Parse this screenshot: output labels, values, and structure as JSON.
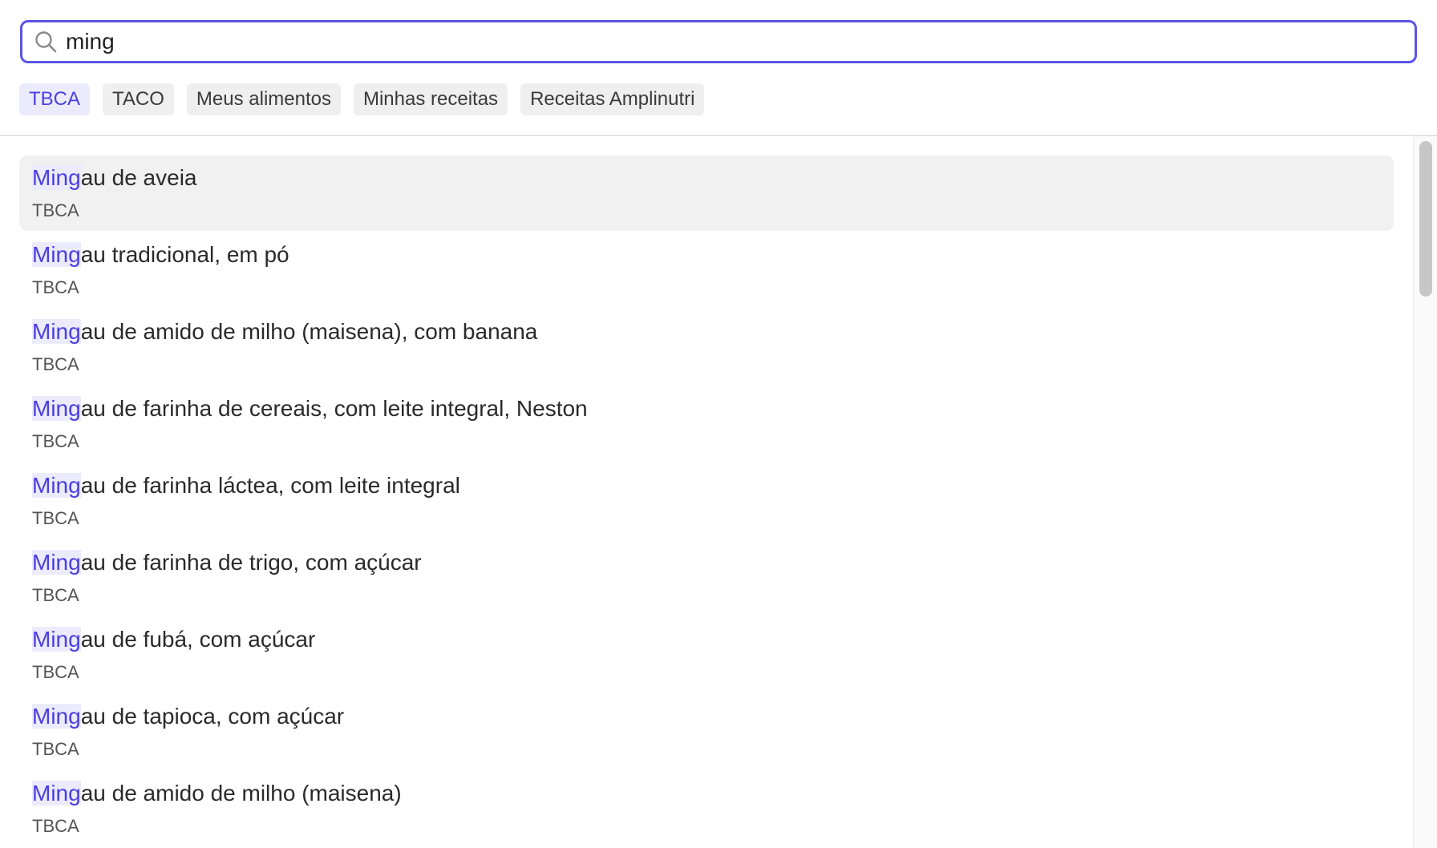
{
  "search": {
    "query": "ming",
    "placeholder": ""
  },
  "filters": [
    {
      "label": "TBCA",
      "active": true
    },
    {
      "label": "TACO",
      "active": false
    },
    {
      "label": "Meus alimentos",
      "active": false
    },
    {
      "label": "Minhas receitas",
      "active": false
    },
    {
      "label": "Receitas Amplinutri",
      "active": false
    }
  ],
  "results": [
    {
      "match": "Ming",
      "rest": "au de aveia",
      "source": "TBCA",
      "selected": true
    },
    {
      "match": "Ming",
      "rest": "au tradicional, em pó",
      "source": "TBCA",
      "selected": false
    },
    {
      "match": "Ming",
      "rest": "au de amido de milho (maisena), com banana",
      "source": "TBCA",
      "selected": false
    },
    {
      "match": "Ming",
      "rest": "au de farinha de cereais, com leite integral, Neston",
      "source": "TBCA",
      "selected": false
    },
    {
      "match": "Ming",
      "rest": "au de farinha láctea, com leite integral",
      "source": "TBCA",
      "selected": false
    },
    {
      "match": "Ming",
      "rest": "au de farinha de trigo, com açúcar",
      "source": "TBCA",
      "selected": false
    },
    {
      "match": "Ming",
      "rest": "au de fubá, com açúcar",
      "source": "TBCA",
      "selected": false
    },
    {
      "match": "Ming",
      "rest": "au de tapioca, com açúcar",
      "source": "TBCA",
      "selected": false
    },
    {
      "match": "Ming",
      "rest": "au de amido de milho (maisena)",
      "source": "TBCA",
      "selected": false
    }
  ],
  "colors": {
    "accent": "#5b55e6",
    "highlight_bg": "#ecebfd",
    "highlight_text": "#4a3fe0"
  }
}
